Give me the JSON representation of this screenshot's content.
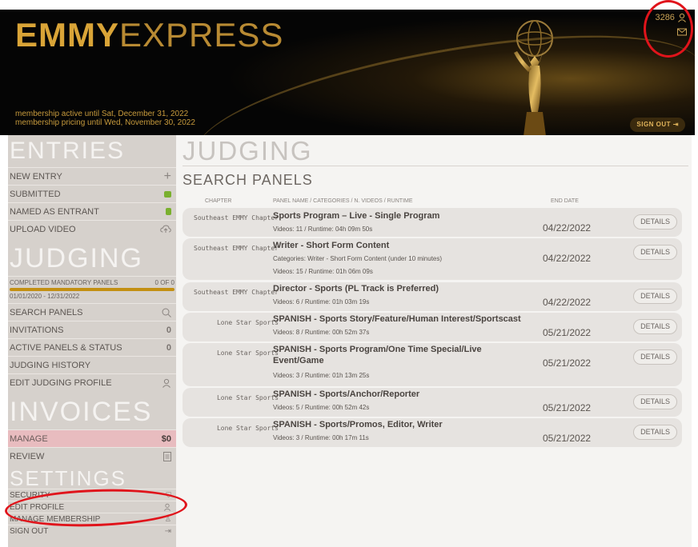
{
  "header": {
    "logo_bold": "EMMY",
    "logo_light": "EXPRESS",
    "membership_line1": "membership active until Sat, December 31, 2022",
    "membership_line2": "membership pricing until Wed, November 30, 2022",
    "user_number": "3286",
    "sign_out_label": "SIGN OUT"
  },
  "sidebar": {
    "entries_title": "ENTRIES",
    "entries": [
      {
        "label": "NEW ENTRY",
        "icon": "plus-icon"
      },
      {
        "label": "SUBMITTED",
        "icon": "submitted-icon"
      },
      {
        "label": "NAMED AS ENTRANT",
        "icon": "named-icon"
      },
      {
        "label": "UPLOAD VIDEO",
        "icon": "cloud-upload-icon"
      }
    ],
    "judging_title": "JUDGING",
    "progress_label": "COMPLETED MANDATORY PANELS",
    "progress_value": "0 of 0",
    "progress_dates": "01/01/2020 - 12/31/2022",
    "judging": [
      {
        "label": "SEARCH PANELS",
        "right": "",
        "icon": "search-icon"
      },
      {
        "label": "INVITATIONS",
        "right": "0"
      },
      {
        "label": "ACTIVE PANELS & STATUS",
        "right": "0"
      },
      {
        "label": "JUDGING HISTORY",
        "right": ""
      },
      {
        "label": "EDIT JUDGING PROFILE",
        "right": "",
        "icon": "user-icon"
      }
    ],
    "invoices_title": "INVOICES",
    "invoices": [
      {
        "label": "MANAGE",
        "right": "$0"
      },
      {
        "label": "REVIEW",
        "right": "",
        "icon": "document-icon"
      }
    ],
    "settings_title": "SETTINGS",
    "settings": [
      {
        "label": "SECURITY"
      },
      {
        "label": "EDIT PROFILE"
      },
      {
        "label": "MANAGE MEMBERSHIP"
      },
      {
        "label": "SIGN OUT"
      }
    ]
  },
  "main": {
    "title": "JUDGING",
    "subtitle": "SEARCH PANELS",
    "columns": {
      "chapter": "CHAPTER",
      "panel": "PANEL NAME / CATEGORIES / N. VIDEOS / RUNTIME",
      "end_date": "END DATE"
    },
    "details_label": "DETAILS",
    "rows": [
      {
        "chapter": "Southeast EMMY Chapter",
        "name": "Sports Program – Live - Single Program",
        "lines": [
          "Videos: 11 / Runtime: 04h 09m 50s"
        ],
        "date": "04/22/2022"
      },
      {
        "chapter": "Southeast EMMY Chapter",
        "name": "Writer - Short Form Content",
        "lines": [
          "Categories: Writer - Short Form Content (under 10 minutes)",
          "Videos: 15 / Runtime: 01h 06m 09s"
        ],
        "date": "04/22/2022"
      },
      {
        "chapter": "Southeast EMMY Chapter",
        "name": "Director - Sports (PL Track is Preferred)",
        "lines": [
          "Videos: 6 / Runtime: 01h 03m 19s"
        ],
        "date": "04/22/2022"
      },
      {
        "chapter": "Lone Star Sports",
        "name": "SPANISH - Sports Story/Feature/Human Interest/Sportscast",
        "lines": [
          "Videos: 8 / Runtime: 00h 52m 37s"
        ],
        "date": "05/21/2022"
      },
      {
        "chapter": "Lone Star Sports",
        "name": "SPANISH - Sports Program/One Time Special/Live Event/Game",
        "lines": [
          "Videos: 3 / Runtime: 01h 13m 25s"
        ],
        "date": "05/21/2022"
      },
      {
        "chapter": "Lone Star Sports",
        "name": "SPANISH - Sports/Anchor/Reporter",
        "lines": [
          "Videos: 5 / Runtime: 00h 52m 42s"
        ],
        "date": "05/21/2022"
      },
      {
        "chapter": "Lone Star Sports",
        "name": "SPANISH - Sports/Promos, Editor, Writer",
        "lines": [
          "Videos: 3 / Runtime: 00h 17m 11s"
        ],
        "date": "05/21/2022"
      }
    ]
  },
  "colors": {
    "gold": "#d9a437",
    "sidebar_bg": "#d6d1cc",
    "progress_bar": "#c39013",
    "annotation_red": "#e0141b"
  }
}
